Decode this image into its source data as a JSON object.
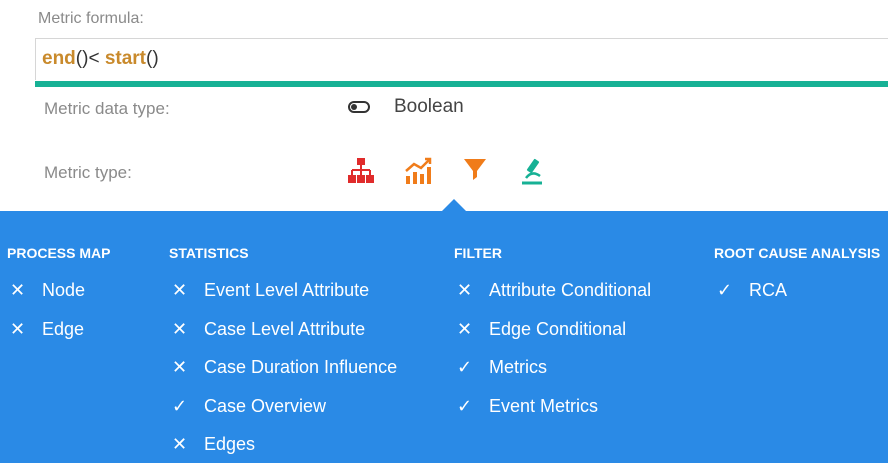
{
  "formula": {
    "label": "Metric formula:",
    "tokens": {
      "fn1": "end",
      "paren1": "()",
      "op": "< ",
      "fn2": "start",
      "paren2": "()"
    }
  },
  "data_type": {
    "label": "Metric data type:",
    "value": "Boolean",
    "icon": "toggle-icon"
  },
  "metric_type": {
    "label": "Metric type:",
    "icons": [
      {
        "name": "process-map-icon",
        "color": "#e02b2b"
      },
      {
        "name": "statistics-icon",
        "color": "#f07c1a"
      },
      {
        "name": "filter-icon",
        "color": "#f07c1a",
        "selected": true
      },
      {
        "name": "rca-icon",
        "color": "#17b195"
      }
    ]
  },
  "panel": {
    "background": "#2a8ae6",
    "columns": [
      {
        "title": "PROCESS MAP",
        "items": [
          {
            "label": "Node",
            "state": "cross"
          },
          {
            "label": "Edge",
            "state": "cross"
          }
        ]
      },
      {
        "title": "STATISTICS",
        "items": [
          {
            "label": "Event Level Attribute",
            "state": "cross"
          },
          {
            "label": "Case Level Attribute",
            "state": "cross"
          },
          {
            "label": "Case Duration Influence",
            "state": "cross"
          },
          {
            "label": "Case Overview",
            "state": "check"
          },
          {
            "label": "Edges",
            "state": "cross"
          }
        ]
      },
      {
        "title": "FILTER",
        "items": [
          {
            "label": "Attribute Conditional",
            "state": "cross"
          },
          {
            "label": "Edge Conditional",
            "state": "cross"
          },
          {
            "label": "Metrics",
            "state": "check"
          },
          {
            "label": "Event Metrics",
            "state": "check"
          }
        ]
      },
      {
        "title": "ROOT CAUSE ANALYSIS",
        "items": [
          {
            "label": "RCA",
            "state": "check"
          }
        ]
      }
    ]
  }
}
